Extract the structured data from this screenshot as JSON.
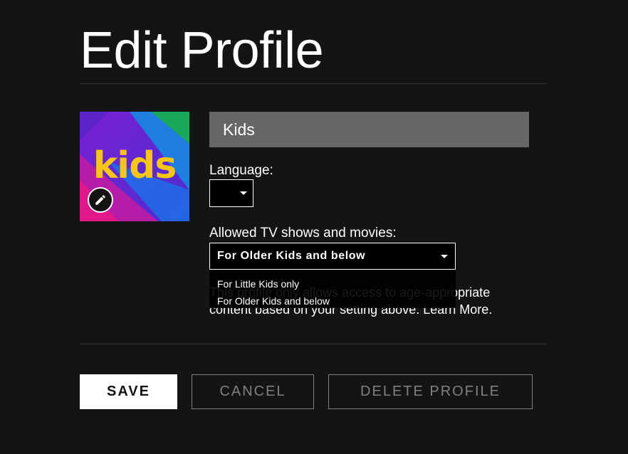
{
  "page": {
    "title": "Edit Profile"
  },
  "profile": {
    "avatar_word": "kids",
    "name_value": "Kids",
    "edit_icon": "pencil-icon"
  },
  "language": {
    "label": "Language:",
    "selected": ""
  },
  "maturity": {
    "label": "Allowed TV shows and movies:",
    "selected": "For Older Kids and below",
    "options": [
      "For Little Kids only",
      "For Older Kids and below"
    ],
    "helper_text": "This profile only allows access to age-appropriate content based on your setting above. Learn More."
  },
  "actions": {
    "save": "SAVE",
    "cancel": "CANCEL",
    "delete": "DELETE PROFILE"
  },
  "colors": {
    "background": "#141414",
    "input_bg": "#666666",
    "divider": "#333333",
    "muted_button": "#808080",
    "avatar_yellow": "#f5c518"
  }
}
